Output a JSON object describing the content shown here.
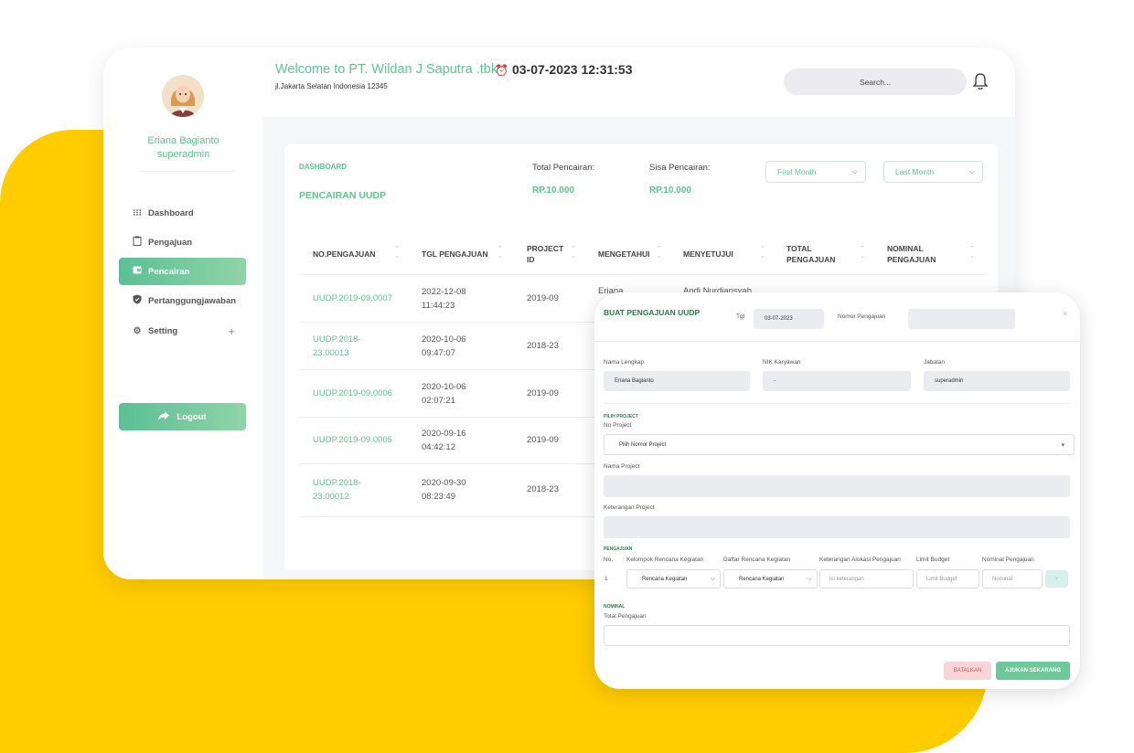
{
  "user": {
    "name": "Eriana Bagianto",
    "role": "superadmin"
  },
  "sidebar": {
    "items": [
      {
        "label": "Dashboard",
        "icon": "grid-icon",
        "active": false
      },
      {
        "label": "Pengajuan",
        "icon": "clipboard-icon",
        "active": false
      },
      {
        "label": "Pencairan",
        "icon": "wallet-icon",
        "active": true
      },
      {
        "label": "Pertanggungjawaban",
        "icon": "shield-icon",
        "active": false
      },
      {
        "label": "Setting",
        "icon": "gear-icon",
        "active": false
      }
    ],
    "setting_plus": "+",
    "logout_label": "Logout"
  },
  "header": {
    "title": "Welcome to PT. Wildan J Saputra .tbk",
    "address": "jl.Jakarta Selatan Indonesia 12345",
    "datetime": "03-07-2023 12:31:53",
    "search_label": "Search..."
  },
  "panel": {
    "breadcrumb": "DASHBOARD",
    "title": "PENCAIRAN UUDP",
    "total_label": "Total Pencairan:",
    "total_value": "RP.10.000",
    "sisa_label": "Sisa Pencairan:",
    "sisa_value": "RP.10.000",
    "filter_from": "First Month",
    "filter_to": "Last Month"
  },
  "table": {
    "headers": [
      "NO.PENGAJUAN",
      "TGL PENGAJUAN",
      "PROJECT ID",
      "MENGETAHUI",
      "MENYETUJUI",
      "TOTAL PENGAJUAN",
      "NOMINAL PENGAJUAN"
    ],
    "rows": [
      {
        "no": "UUDP.2019-09.0007",
        "tgl": "2022-12-08 11:44:23",
        "project": "2019-09",
        "mengetahui": "Eriana",
        "menyetujui": "Andi Nurdiansyah"
      },
      {
        "no": "UUDP.2018-23.00013",
        "tgl": "2020-10-06 09:47:07",
        "project": "2018-23"
      },
      {
        "no": "UUDP.2019-09.0006",
        "tgl": "2020-10-06 02:07:21",
        "project": "2019-09"
      },
      {
        "no": "UUDP.2019-09.0005",
        "tgl": "2020-09-16 04:42:12",
        "project": "2019-09"
      },
      {
        "no": "UUDP.2018-23.00012",
        "tgl": "2020-09-30 08:23:49",
        "project": "2018-23"
      }
    ]
  },
  "modal": {
    "title": "BUAT PENGAJUAN UUDP",
    "tgl_label": "Tgl",
    "tgl_value": "03-07-2023",
    "nomor_label": "Nomor Pengajuan",
    "close": "×",
    "nama_lengkap_label": "Nama Lengkap",
    "nama_lengkap_value": "Eriana Bagianto",
    "nik_label": "NIK Karyawan",
    "nik_value": "-",
    "jabatan_label": "Jabatan",
    "jabatan_value": "superadmin",
    "pilih_project_section": "PILIH PROJECT",
    "no_project_label": "No Project",
    "no_project_placeholder": "Pilih Nomor Project",
    "nama_project_label": "Nama Project",
    "keterangan_project_label": "Keterangan Project",
    "pengajuan_section": "PENGAJUAN",
    "cols": [
      "No.",
      "Kelompok Rencana Kegiatan",
      "Daftar Rencana Kegiatan",
      "Keterangan Alokasi Pengajuan",
      "Limit Budget",
      "Nominal Pengajuan"
    ],
    "row_no": "1",
    "kelompok_value": "Rencana Kegiatan",
    "daftar_value": "Rencana Kegiatan",
    "keterangan_placeholder": "Isi keterangan",
    "limit_placeholder": "Limit Budget",
    "nominal_placeholder": "Nominal",
    "add_row": "+",
    "nominal_section": "NOMINAL",
    "total_label": "Total Pengajuan",
    "cancel_label": "BATALKAN",
    "submit_label": "AJUKAN SEKARANG"
  },
  "colors": {
    "accent": "#5cc58f",
    "yellow": "#FFCC00",
    "cancel": "#f6d6d8",
    "submit": "#6cc99a"
  }
}
